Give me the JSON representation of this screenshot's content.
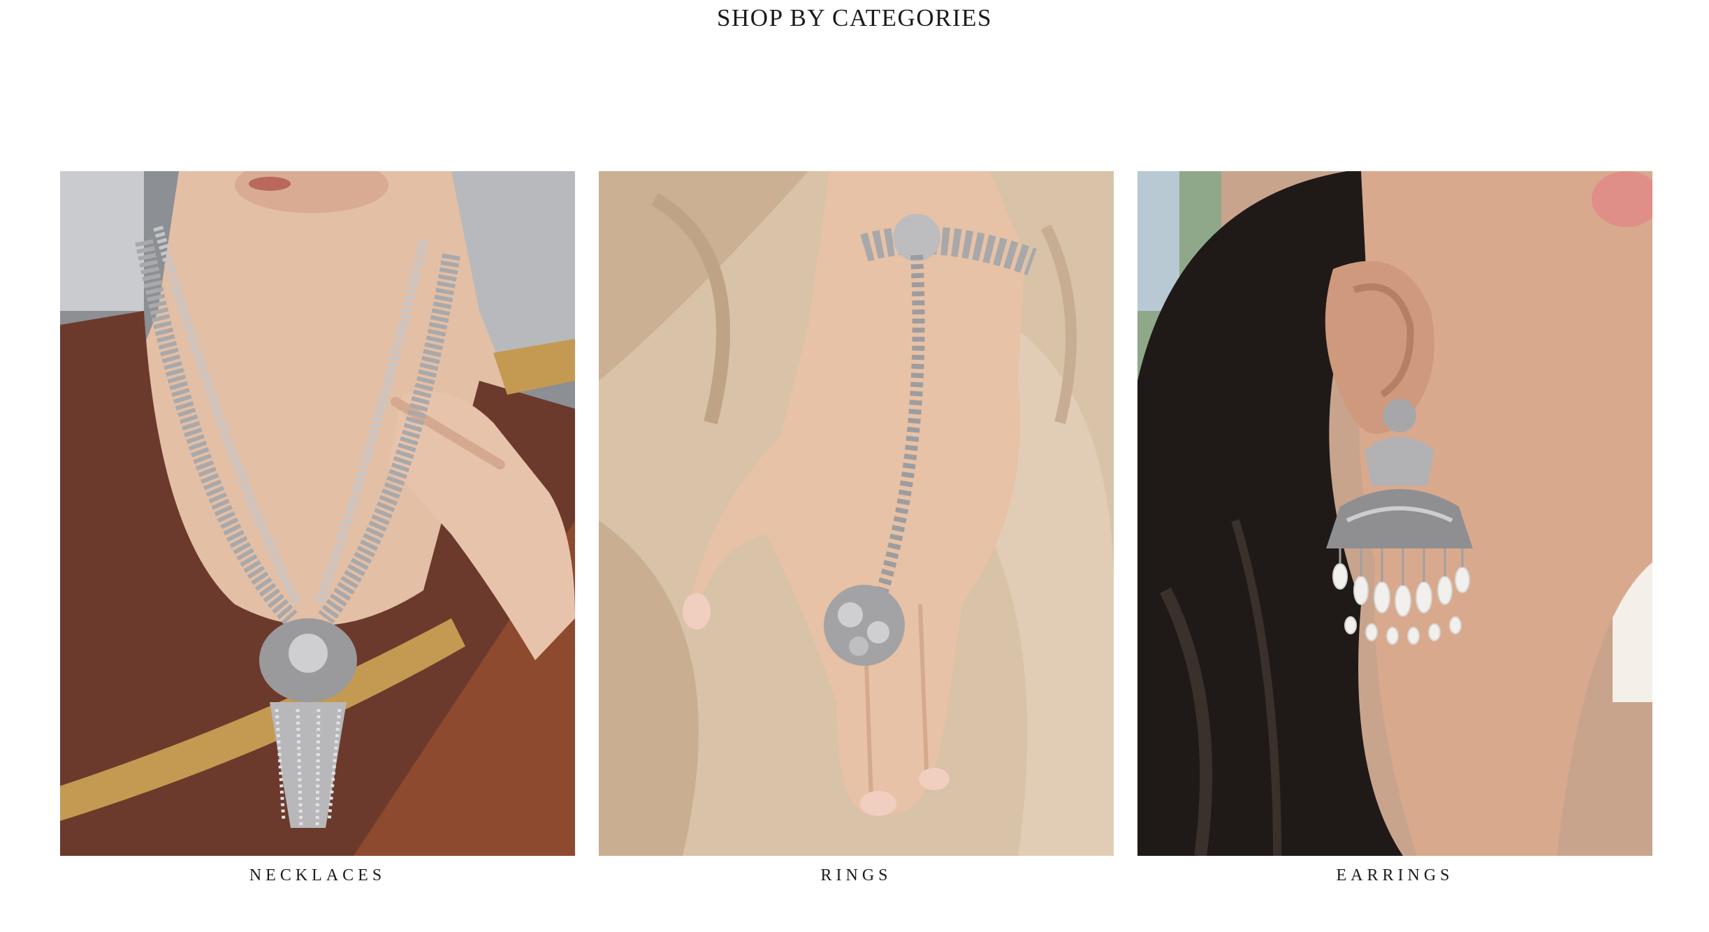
{
  "section": {
    "title": "SHOP BY CATEGORIES"
  },
  "categories": [
    {
      "label": "NECKLACES",
      "image": "woman-wearing-layered-silver-necklace-with-peacock-pendant"
    },
    {
      "label": "RINGS",
      "image": "hand-wearing-silver-ghungroo-hand-harness-ring"
    },
    {
      "label": "EARRINGS",
      "image": "ear-wearing-silver-peacock-chandbali-earring-with-pearls"
    }
  ],
  "colors": {
    "text": "#1a1a1a",
    "background": "#ffffff"
  }
}
